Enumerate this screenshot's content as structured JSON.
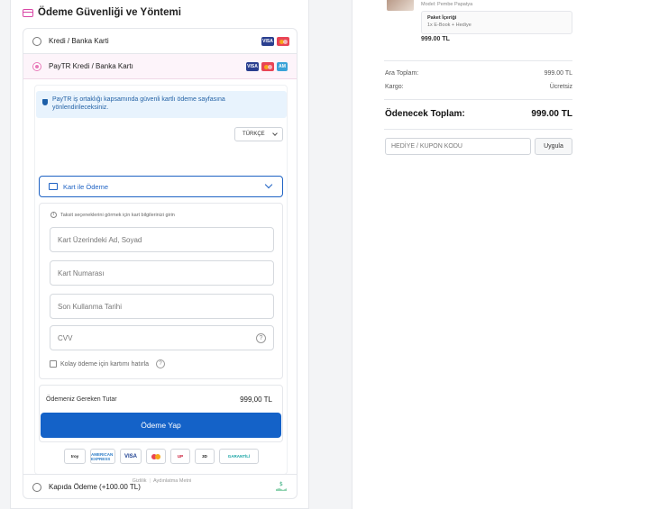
{
  "section_title": "Ödeme Güvenliği ve Yöntemi",
  "methods": {
    "credit_card": "Kredi / Banka Karti",
    "paytr": "PayTR Kredi / Banka Kartı",
    "cod": "Kapıda Ödeme (+100.00 TL)"
  },
  "paytr": {
    "info": "PayTR iş ortaklığı kapsamında güvenli kartlı ödeme sayfasına yönlendirileceksiniz.",
    "language": "TÜRKÇE",
    "pay_option": "Kart ile Ödeme",
    "hint": "Taksit seçeneklerini görmek için kart bilgilerinizi girin",
    "fields": {
      "name": "Kart Üzerindeki Ad, Soyad",
      "number": "Kart Numarası",
      "expiry": "Son Kullanma Tarihi",
      "cvv": "CVV"
    },
    "remember": "Kolay ödeme için kartımı hatırla",
    "total_label": "Ödemeniz Gereken Tutar",
    "total_value": "999,00 TL",
    "pay_button": "Ödeme Yap",
    "logos": [
      "troy",
      "AMERICAN EXPRESS",
      "VISA",
      "MC",
      "UnionPay",
      "3D SECURE",
      "GARANTİLİ"
    ],
    "footer": [
      "Gizlilik",
      "Aydınlatma Metni"
    ]
  },
  "cart": {
    "model": "Model: Pembe Papatya",
    "package_title": "Paket İçeriği",
    "package_desc": "1x E-Book + Hediye",
    "product_price": "999.00 TL",
    "subtotal_label": "Ara Toplam:",
    "subtotal_value": "999.00 TL",
    "shipping_label": "Kargo:",
    "shipping_value": "Ücretsiz",
    "grand_label": "Ödenecek Toplam:",
    "grand_value": "999.00 TL",
    "coupon_placeholder": "HEDİYE / KUPON KODU",
    "apply_button": "Uygula"
  },
  "colors": {
    "primary": "#1462c8",
    "accent": "#e879b9"
  }
}
